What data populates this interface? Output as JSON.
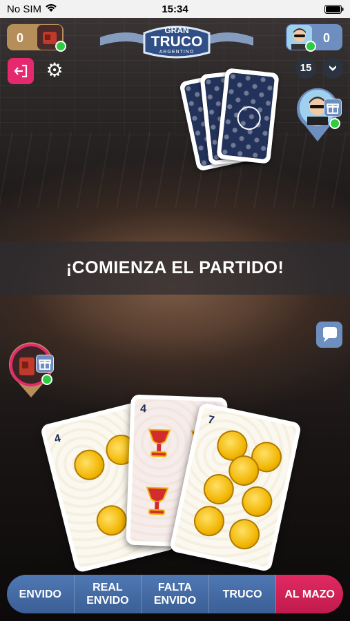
{
  "status_bar": {
    "carrier": "No SIM",
    "time": "15:34"
  },
  "scoreboard": {
    "left_score": "0",
    "right_score": "0"
  },
  "logo": {
    "line1": "GRAN",
    "line2": "TRUCO",
    "line3": "ARGENTINO"
  },
  "round_counter": "15",
  "banner": {
    "text": "¡COMIENZA EL PARTIDO!"
  },
  "hand": [
    {
      "number": "4",
      "suit": "oros"
    },
    {
      "number": "4",
      "suit": "copas"
    },
    {
      "number": "7",
      "suit": "oros"
    }
  ],
  "actions": [
    {
      "label": "ENVIDO",
      "color": "#4f78b3"
    },
    {
      "label": "REAL\nENVIDO",
      "color": "#4f78b3"
    },
    {
      "label": "FALTA\nENVIDO",
      "color": "#4f78b3"
    },
    {
      "label": "TRUCO",
      "color": "#4f78b3"
    },
    {
      "label": "AL MAZO",
      "color": "#e02b62"
    }
  ],
  "icons": {
    "exit": "exit-icon",
    "settings": "gear-icon",
    "deck": "deck-icon",
    "gift": "gift-icon",
    "chat": "chat-bubble-icon"
  }
}
